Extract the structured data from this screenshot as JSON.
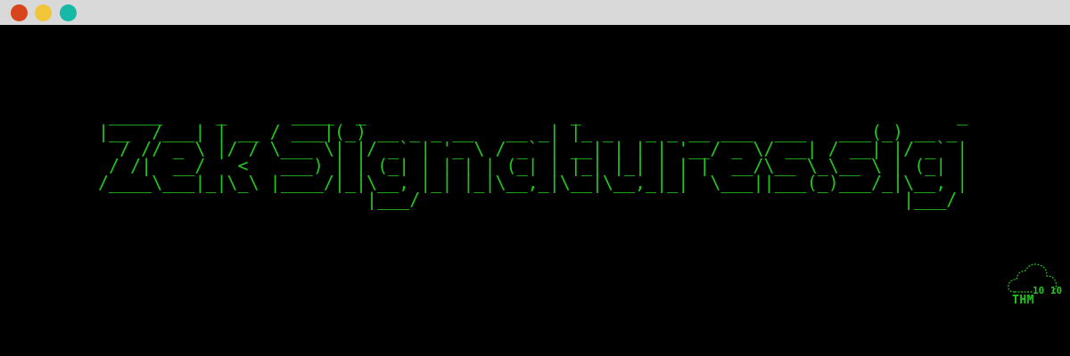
{
  "window": {
    "controls": {
      "close_color": "#d8451d",
      "minimize_color": "#f1c53a",
      "maximize_color": "#16b9a5"
    }
  },
  "terminal": {
    "background": "#000000",
    "text_color": "#22c51f",
    "ascii_banner": " _____     _      ____  _                   _                                   _\n|__  /___| | __ / ___|(_) __ _ _ __   __ _| |_ _   _ _ __ ___  ___   ___(_) __ _\n  / // _ \\ |/ / \\___ \\| |/ _` | '_ \\ / _` | __| | | | '__/ _ \\/ __| / __| |/ _` |\n / /|  __/   <   ___) | | (_| | | | | (_| | |_| |_| | | |  __/\\__ \\_\\__ \\ | (_| |\n/____\\___|_|\\_\\ |____/|_|\\__, |_| |_|\\__,_|\\__|\\__,_|_|  \\___||___(_)___/_|\\__, |\n                         |___/                                             |___/"
  },
  "logo": {
    "icon": "cloud-icon",
    "label": "THM",
    "binary": "10 10"
  }
}
